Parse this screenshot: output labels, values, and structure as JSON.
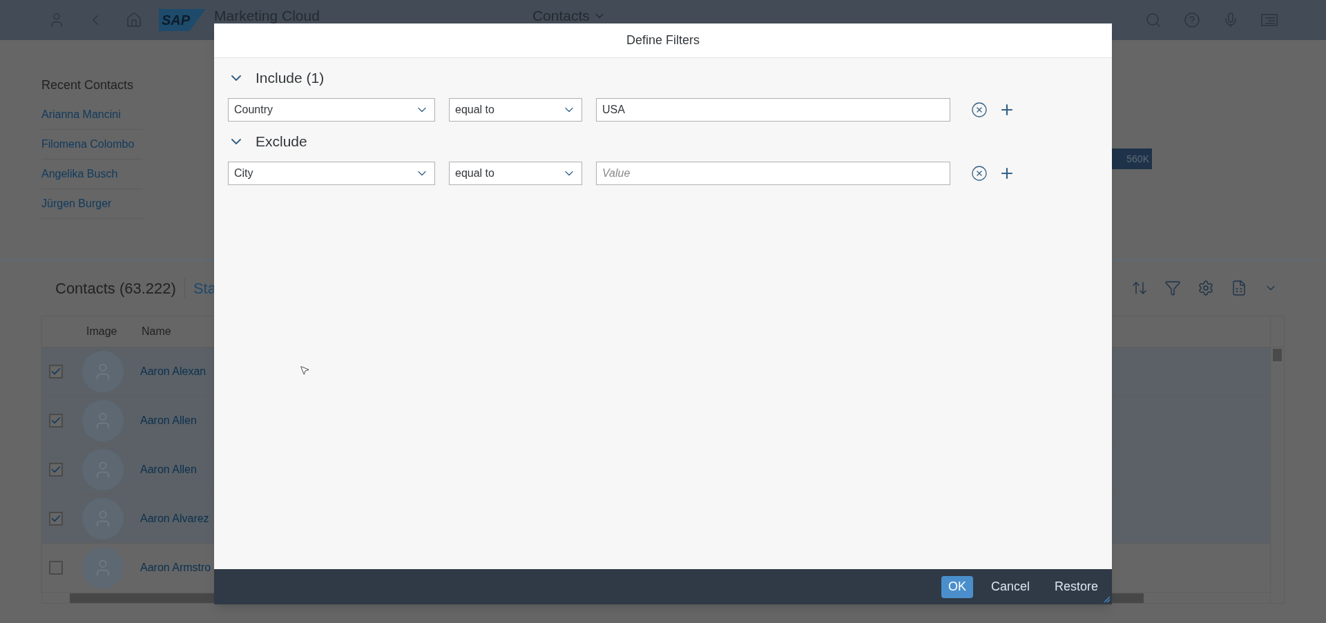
{
  "top_bar": {
    "logo_text": "SAP",
    "app_title": "Marketing Cloud",
    "page_title": "Contacts"
  },
  "recent_contacts": {
    "title": "Recent Contacts",
    "items": [
      "Arianna Mancini",
      "Filomena Colombo",
      "Angelika Busch",
      "Jürgen Burger"
    ]
  },
  "kpi": {
    "value": "560K"
  },
  "contacts_table": {
    "title": "Contacts (63.222)",
    "tab": "Sta",
    "columns": [
      "Image",
      "Name"
    ],
    "rows": [
      {
        "name": "Aaron Alexan",
        "checked": true
      },
      {
        "name": "Aaron Allen",
        "checked": true
      },
      {
        "name": "Aaron Allen",
        "checked": true
      },
      {
        "name": "Aaron Alvarez",
        "checked": true
      },
      {
        "name": "Aaron Armstro",
        "checked": false
      }
    ]
  },
  "dialog": {
    "title": "Define Filters",
    "sections": [
      {
        "title": "Include (1)",
        "expanded": true,
        "conditions": [
          {
            "field": "Country",
            "operator": "equal to",
            "value": "USA"
          }
        ]
      },
      {
        "title": "Exclude",
        "expanded": true,
        "conditions": [
          {
            "field": "City",
            "operator": "equal to",
            "placeholder": "Value"
          }
        ]
      }
    ],
    "buttons": [
      {
        "label": "OK",
        "kind": "primary"
      },
      {
        "label": "Cancel",
        "kind": "plain"
      },
      {
        "label": "Restore",
        "kind": "plain"
      }
    ]
  }
}
